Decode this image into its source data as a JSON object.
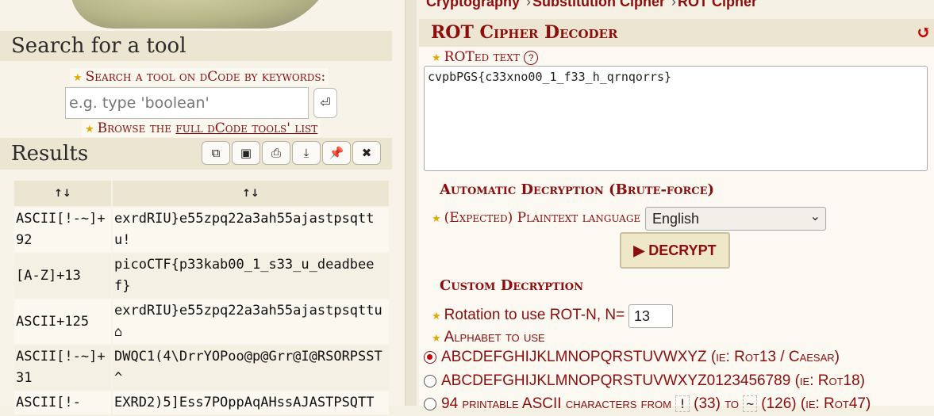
{
  "search": {
    "title": "Search for a tool",
    "keywords_label": "Search a tool on dCode by keywords:",
    "placeholder": "e.g. type 'boolean'",
    "go_icon": "⏎",
    "browse_prefix": "Browse the ",
    "browse_link": "full dCode tools' list"
  },
  "results": {
    "title": "Results",
    "toolbar": [
      {
        "name": "copy-icon",
        "glyph": "⧉"
      },
      {
        "name": "screenshot-icon",
        "glyph": "▣"
      },
      {
        "name": "print-icon",
        "glyph": "⎙"
      },
      {
        "name": "download-icon",
        "glyph": "⤓"
      },
      {
        "name": "pin-icon",
        "glyph": "📌"
      },
      {
        "name": "close-icon",
        "glyph": "✖"
      }
    ],
    "headers": [
      "↑↓",
      "↑↓"
    ],
    "rows": [
      {
        "method": "ASCII[!-~]+92",
        "text": "exrdRIU}e55zpq22a3ah55ajastpsqttu!"
      },
      {
        "method": "[A-Z]+13",
        "text": "picoCTF{p33kab00_1_s33_u_deadbeef}"
      },
      {
        "method": "ASCII+125",
        "text": "exrdRIU}e55zpq22a3ah55ajastpsqttu⌂"
      },
      {
        "method": "ASCII[!-~]+31",
        "text": "DWQC1(4\\DrrYOPoo@p@Grr@I@RSORPSST^"
      },
      {
        "method": "ASCII[!-",
        "text": "EXRD2)5]Ess7POppAqAHssAJASTPSQTT"
      }
    ]
  },
  "breadcrumb": {
    "items": [
      "Cryptography",
      "Substitution Cipher",
      "ROT Cipher"
    ],
    "separator": "›"
  },
  "decoder": {
    "title": "ROT Cipher Decoder",
    "reset_icon": "↺",
    "input_label": "ROTed text",
    "help_icon": "?",
    "input_value": "cvpbPGS{c33xno00_1_f33_h_qrnqorrs}",
    "auto_heading": "Automatic Decryption (Brute-force)",
    "language_label": "(Expected) Plaintext language",
    "language_value": "English",
    "decrypt_label": "▶ DECRYPT",
    "custom_heading": "Custom Decryption",
    "rotation_label": "Rotation to use ROT-N, N=",
    "rotation_value": "13",
    "alphabet_label": "Alphabet to use",
    "alphabets": [
      {
        "label": "ABCDEFGHIJKLMNOPQRSTUVWXYZ",
        "hint": "(ie: Rot13 / Caesar)",
        "selected": true
      },
      {
        "label": "ABCDEFGHIJKLMNOPQRSTUVWXYZ0123456789",
        "hint": "(ie: Rot18)",
        "selected": false
      },
      {
        "label": "94 printable ASCII characters from",
        "hint": "(ie: Rot47)",
        "from": "!",
        "from_code": "(33) to",
        "to": "~",
        "to_code": "(126)",
        "selected": false
      }
    ]
  },
  "colors": {
    "accent": "#8b0d0d",
    "star": "#e0a800",
    "panel_header": "#ebe5d2"
  }
}
